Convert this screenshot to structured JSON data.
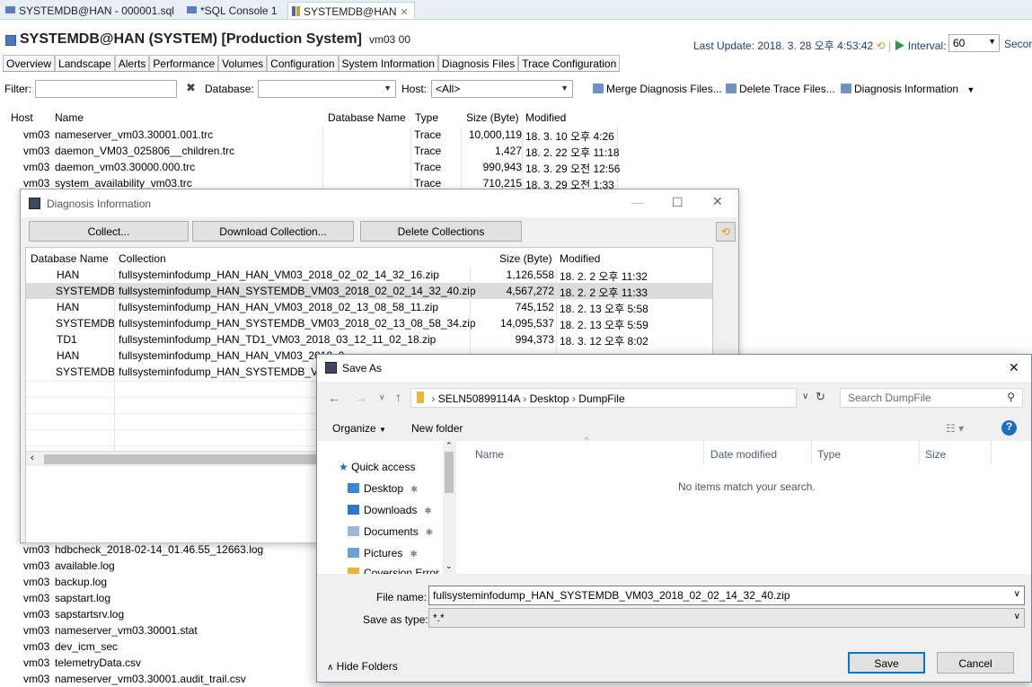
{
  "editor_tabs": [
    {
      "label": "SYSTEMDB@HAN - 000001.sql"
    },
    {
      "label": "*SQL Console 1"
    },
    {
      "label": "SYSTEMDB@HAN"
    }
  ],
  "header": {
    "title": "SYSTEMDB@HAN (SYSTEM) [Production System]",
    "host": "vm03 00",
    "last_update": "Last Update:  2018. 3. 28 오후 4:53:42",
    "interval_label": "Interval:",
    "interval_value": "60",
    "seconds": "Secon"
  },
  "section_tabs": [
    "Overview",
    "Landscape",
    "Alerts",
    "Performance",
    "Volumes",
    "Configuration",
    "System Information",
    "Diagnosis Files",
    "Trace Configuration"
  ],
  "filter": {
    "filter_label": "Filter:",
    "database_label": "Database:",
    "host_label": "Host:",
    "host_value": "<All>",
    "merge": "Merge Diagnosis Files...",
    "delete_trace": "Delete Trace Files...",
    "diag_info": "Diagnosis Information"
  },
  "main_table": {
    "headers": {
      "host": "Host",
      "name": "Name",
      "db": "Database Name",
      "type": "Type",
      "size": "Size (Byte)",
      "modified": "Modified"
    },
    "rows_top": [
      {
        "host": "vm03",
        "name": "nameserver_vm03.30001.001.trc",
        "type": "Trace",
        "size": "10,000,119",
        "modified": "18. 3. 10 오후 4:26"
      },
      {
        "host": "vm03",
        "name": "daemon_VM03_025806__children.trc",
        "type": "Trace",
        "size": "1,427",
        "modified": "18. 2. 22 오후 11:18"
      },
      {
        "host": "vm03",
        "name": "daemon_vm03.30000.000.trc",
        "type": "Trace",
        "size": "990,943",
        "modified": "18. 3. 29 오전 12:56"
      },
      {
        "host": "vm03",
        "name": "system_availability_vm03.trc",
        "type": "Trace",
        "size": "710,215",
        "modified": "18. 3. 29 오전 1:33"
      }
    ],
    "rows_bottom": [
      {
        "host": "vm03",
        "name": "hdbcheck_2018-02-14_01.46.55_12663.log"
      },
      {
        "host": "vm03",
        "name": "available.log"
      },
      {
        "host": "vm03",
        "name": "backup.log"
      },
      {
        "host": "vm03",
        "name": "sapstart.log"
      },
      {
        "host": "vm03",
        "name": "sapstartsrv.log"
      },
      {
        "host": "vm03",
        "name": "nameserver_vm03.30001.stat"
      },
      {
        "host": "vm03",
        "name": "dev_icm_sec"
      },
      {
        "host": "vm03",
        "name": "telemetryData.csv"
      },
      {
        "host": "vm03",
        "name": "nameserver_vm03.30001.audit_trail.csv"
      }
    ]
  },
  "diag_window": {
    "title": "Diagnosis Information",
    "collect": "Collect...",
    "download": "Download Collection...",
    "delete": "Delete Collections",
    "headers": {
      "db": "Database Name",
      "collection": "Collection",
      "size": "Size (Byte)",
      "modified": "Modified"
    },
    "rows": [
      {
        "db": "HAN",
        "collection": "fullsysteminfodump_HAN_HAN_VM03_2018_02_02_14_32_16.zip",
        "size": "1,126,558",
        "modified": "18. 2. 2 오후 11:32"
      },
      {
        "db": "SYSTEMDB",
        "collection": "fullsysteminfodump_HAN_SYSTEMDB_VM03_2018_02_02_14_32_40.zip",
        "size": "4,567,272",
        "modified": "18. 2. 2 오후 11:33"
      },
      {
        "db": "HAN",
        "collection": "fullsysteminfodump_HAN_HAN_VM03_2018_02_13_08_58_11.zip",
        "size": "745,152",
        "modified": "18. 2. 13 오후 5:58"
      },
      {
        "db": "SYSTEMDB",
        "collection": "fullsysteminfodump_HAN_SYSTEMDB_VM03_2018_02_13_08_58_34.zip",
        "size": "14,095,537",
        "modified": "18. 2. 13 오후 5:59"
      },
      {
        "db": "TD1",
        "collection": "fullsysteminfodump_HAN_TD1_VM03_2018_03_12_11_02_18.zip",
        "size": "994,373",
        "modified": "18. 3. 12 오후 8:02"
      },
      {
        "db": "HAN",
        "collection": "fullsysteminfodump_HAN_HAN_VM03_2018_0",
        "size": "",
        "modified": ""
      },
      {
        "db": "SYSTEMDB",
        "collection": "fullsysteminfodump_HAN_SYSTEMDB_VM",
        "size": "",
        "modified": ""
      }
    ]
  },
  "save_as": {
    "title": "Save As",
    "breadcrumb": [
      "SELN50899114A",
      "Desktop",
      "DumpFile"
    ],
    "search_placeholder": "Search DumpFile",
    "organize": "Organize",
    "new_folder": "New folder",
    "nav": [
      {
        "label": "Quick access"
      },
      {
        "label": "Desktop"
      },
      {
        "label": "Downloads"
      },
      {
        "label": "Documents"
      },
      {
        "label": "Pictures"
      },
      {
        "label": "Coversion Error"
      }
    ],
    "columns": {
      "name": "Name",
      "date": "Date modified",
      "type": "Type",
      "size": "Size"
    },
    "empty_message": "No items match your search.",
    "file_name_label": "File name:",
    "file_name_value": "fullsysteminfodump_HAN_SYSTEMDB_VM03_2018_02_02_14_32_40.zip",
    "save_type_label": "Save as type:",
    "save_type_value": "*.*",
    "hide_folders": "Hide Folders",
    "save": "Save",
    "cancel": "Cancel"
  }
}
